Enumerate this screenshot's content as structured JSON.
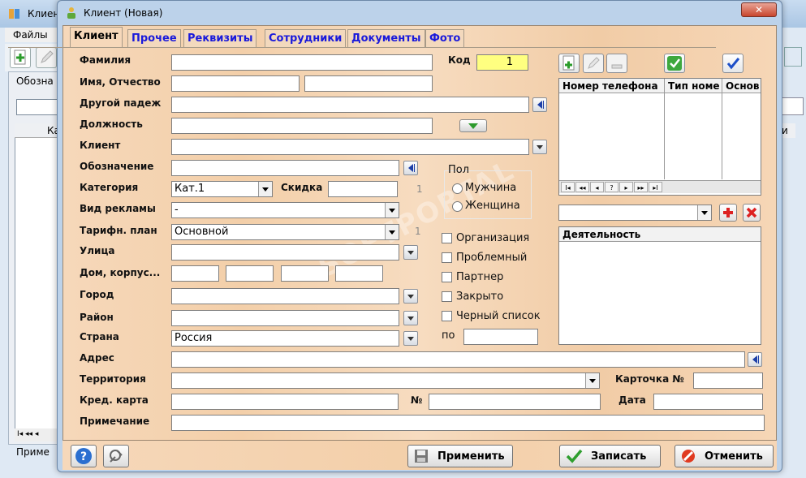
{
  "background_window": {
    "title": "Клиент",
    "menu_files": "Файлы",
    "label_partial": "Обозна",
    "grid_header_partial": "Ка",
    "bottom_partial": "Приме",
    "right_header_partial": "и"
  },
  "dialog": {
    "title": "Клиент  (Новая)",
    "close_label": "✕"
  },
  "tabs": [
    "Клиент",
    "Прочее",
    "Реквизиты",
    "Сотрудники",
    "Документы",
    "Фото"
  ],
  "form": {
    "familiya": {
      "label": "Фамилия",
      "value": ""
    },
    "kod": {
      "label": "Код",
      "value": "1"
    },
    "imya": {
      "label": "Имя, Отчество",
      "value1": "",
      "value2": ""
    },
    "drugoy": {
      "label": "Другой падеж",
      "value": ""
    },
    "dolzhnost": {
      "label": "Должность",
      "value": ""
    },
    "klient": {
      "label": "Клиент",
      "value": ""
    },
    "oboznach": {
      "label": "Обозначение",
      "value": ""
    },
    "kategoriya": {
      "label": "Категория",
      "value": "Кат.1"
    },
    "skidka": {
      "label": "Скидка",
      "value": "",
      "extra": "1"
    },
    "vid_reklamy": {
      "label": "Вид рекламы",
      "value": "-"
    },
    "tarif": {
      "label": "Тарифн. план",
      "value": "Основной",
      "extra": "1"
    },
    "ulica": {
      "label": "Улица",
      "value": ""
    },
    "dom": {
      "label": "Дом, корпус..."
    },
    "gorod": {
      "label": "Город",
      "value": ""
    },
    "rayon": {
      "label": "Район",
      "value": ""
    },
    "strana": {
      "label": "Страна",
      "value": "Россия"
    },
    "adres": {
      "label": "Адрес",
      "value": ""
    },
    "territoriya": {
      "label": "Территория",
      "value": ""
    },
    "kartochka": {
      "label": "Карточка №",
      "value": ""
    },
    "kred": {
      "label": "Кред. карта",
      "value": ""
    },
    "num_label": "№",
    "data": {
      "label": "Дата",
      "value": ""
    },
    "primechanie": {
      "label": "Примечание",
      "value": ""
    }
  },
  "pol": {
    "label": "Пол",
    "options": [
      "Мужчина",
      "Женщина"
    ]
  },
  "flags": [
    "Организация",
    "Проблемный",
    "Партнер",
    "Закрыто",
    "Черный список"
  ],
  "po": {
    "label": "по",
    "value": ""
  },
  "phones": {
    "headers": [
      "Номер телефона",
      "Тип номе",
      "Основ"
    ],
    "nav": [
      "I◂",
      "◂◂",
      "◂",
      "?",
      "▸",
      "▸▸",
      "▸I"
    ]
  },
  "deyatelnost": {
    "header": "Деятельность",
    "combo_value": ""
  },
  "buttons": {
    "apply": "Применить",
    "save": "Записать",
    "cancel": "Отменить"
  },
  "watermark": "SOFTPORTAL"
}
